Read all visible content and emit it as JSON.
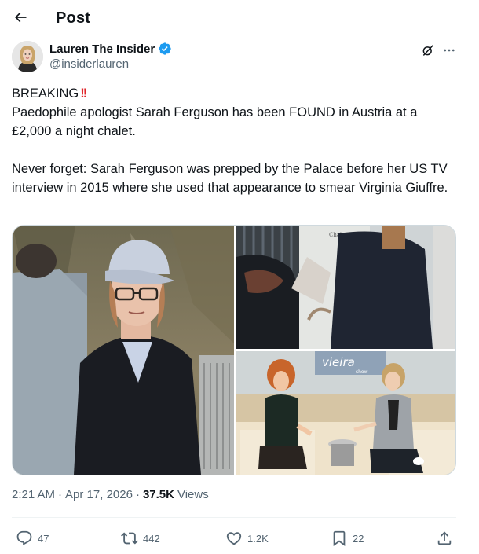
{
  "header": {
    "title": "Post"
  },
  "author": {
    "display_name": "Lauren The Insider",
    "handle": "@insiderlauren",
    "verified": true
  },
  "tweet": {
    "line1": "BREAKING",
    "emoji": "!!",
    "line2": "Paedophile apologist Sarah Ferguson has been FOUND in Austria at a £2,000 a night chalet.",
    "line3": "Never forget: Sarah Ferguson was prepped by the Palace before her US TV interview in 2015 where she used that appearance to smear Virginia Giuffre."
  },
  "media": {
    "count": 3,
    "tv_logo": "vieira",
    "tv_logo_sub": "show"
  },
  "meta": {
    "time": "2:21 AM",
    "separator": "·",
    "date": "Apr 17, 2026",
    "views_count": "37.5K",
    "views_label": "Views"
  },
  "actions": {
    "replies": "47",
    "reposts": "442",
    "likes": "1.2K",
    "bookmarks": "22"
  },
  "colors": {
    "text_primary": "#0f1419",
    "text_secondary": "#536471",
    "verified_blue": "#1d9bf0",
    "border": "#cfd9de",
    "emoji_red": "#e0262b"
  }
}
